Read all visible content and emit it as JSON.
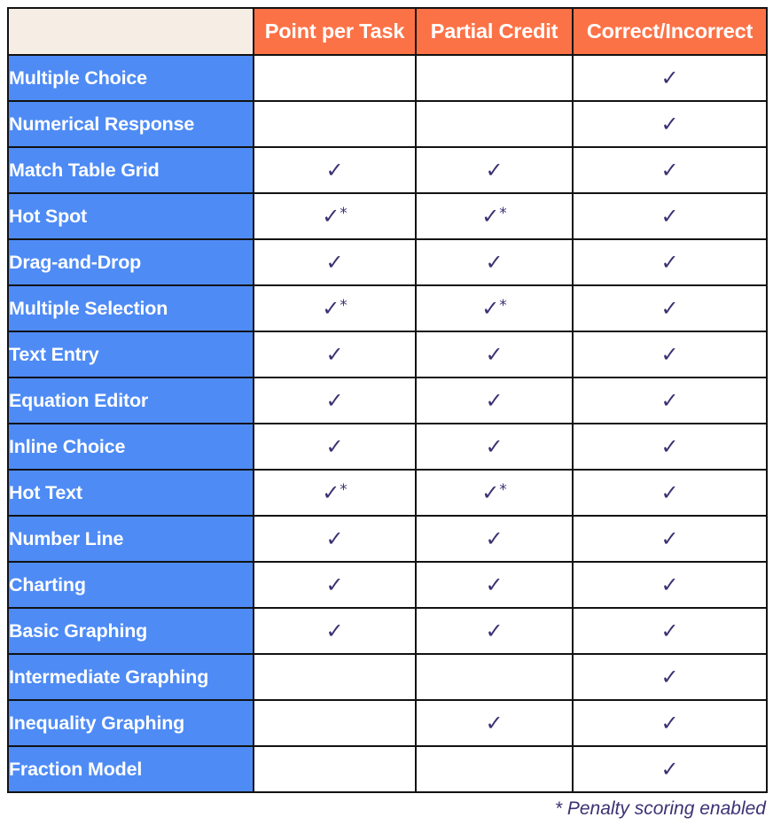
{
  "colors": {
    "header_accent": "#fc7247",
    "corner_cell": "#f6eee4",
    "row_label": "#4e8bf5",
    "mark": "#3b3273",
    "border": "#121212",
    "cell_background": "#ffffff"
  },
  "table": {
    "corner_label": "",
    "columns": [
      {
        "key": "point_per_task",
        "label": "Point per Task"
      },
      {
        "key": "partial_credit",
        "label": "Partial Credit"
      },
      {
        "key": "correct_incorrect",
        "label": "Correct/Incorrect"
      }
    ],
    "check_glyph": "✓",
    "penalty_marker": "*",
    "rows": [
      {
        "label": "Multiple Choice",
        "cells": [
          "",
          "",
          "check"
        ]
      },
      {
        "label": "Numerical Response",
        "cells": [
          "",
          "",
          "check"
        ]
      },
      {
        "label": "Match Table Grid",
        "cells": [
          "check",
          "check",
          "check"
        ]
      },
      {
        "label": "Hot Spot",
        "cells": [
          "check-star",
          "check-star",
          "check"
        ]
      },
      {
        "label": "Drag-and-Drop",
        "cells": [
          "check",
          "check",
          "check"
        ]
      },
      {
        "label": "Multiple Selection",
        "cells": [
          "check-star",
          "check-star",
          "check"
        ]
      },
      {
        "label": "Text Entry",
        "cells": [
          "check",
          "check",
          "check"
        ]
      },
      {
        "label": "Equation Editor",
        "cells": [
          "check",
          "check",
          "check"
        ]
      },
      {
        "label": "Inline Choice",
        "cells": [
          "check",
          "check",
          "check"
        ]
      },
      {
        "label": "Hot Text",
        "cells": [
          "check-star",
          "check-star",
          "check"
        ]
      },
      {
        "label": "Number Line",
        "cells": [
          "check",
          "check",
          "check"
        ]
      },
      {
        "label": "Charting",
        "cells": [
          "check",
          "check",
          "check"
        ]
      },
      {
        "label": "Basic Graphing",
        "cells": [
          "check",
          "check",
          "check"
        ]
      },
      {
        "label": "Intermediate Graphing",
        "cells": [
          "",
          "",
          "check"
        ]
      },
      {
        "label": "Inequality Graphing",
        "cells": [
          "",
          "check",
          "check"
        ]
      },
      {
        "label": "Fraction Model",
        "cells": [
          "",
          "",
          "check"
        ]
      }
    ]
  },
  "footnote": {
    "text": "* Penalty scoring enabled"
  }
}
